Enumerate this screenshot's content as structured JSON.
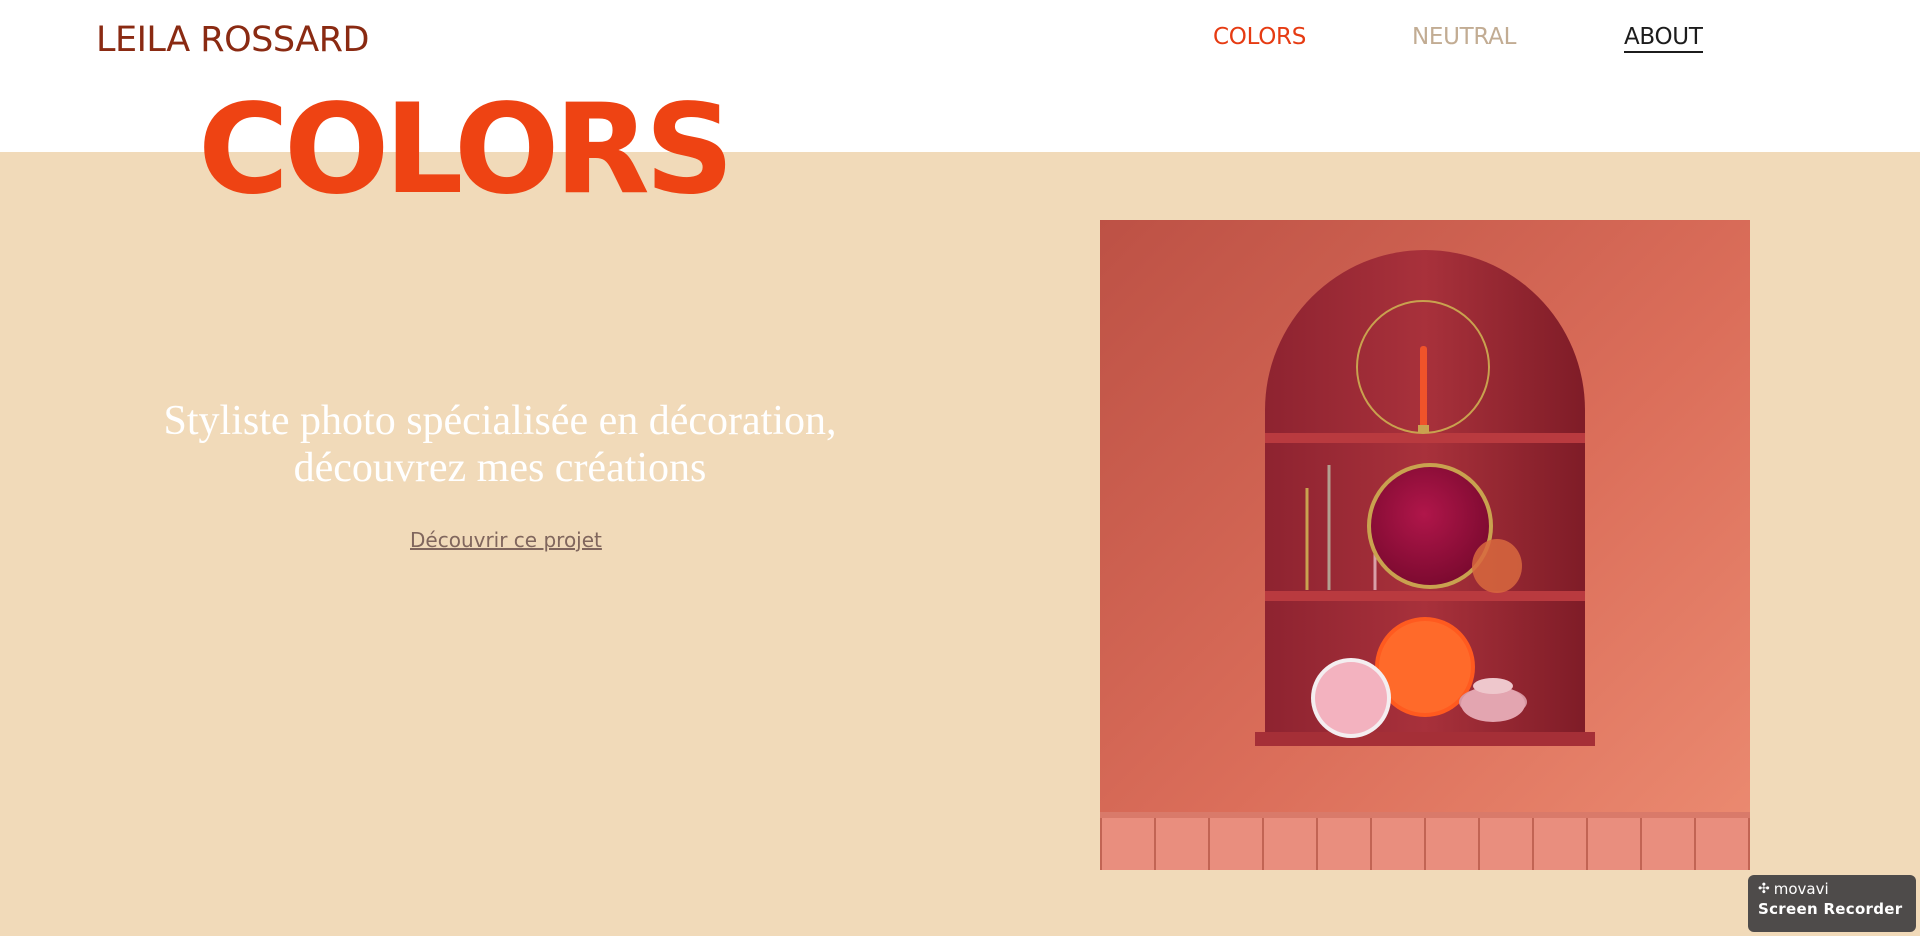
{
  "site": {
    "logo": "LEILA ROSSARD"
  },
  "nav": {
    "items": [
      {
        "label": "COLORS",
        "color": "#e63b12"
      },
      {
        "label": "NEUTRAL",
        "color": "#c2ac93"
      },
      {
        "label": "ABOUT",
        "color": "#1c1c1c"
      }
    ]
  },
  "hero": {
    "title": "COLORS",
    "tagline_line1": "Styliste photo spécialisée en décoration,",
    "tagline_line2": "découvrez mes créations",
    "cta_label": "Découvrir ce projet",
    "band_color": "#f1dab9",
    "title_color": "#ee4313"
  },
  "photo": {
    "subject": "arched red niche with shelves, candlestick, candle holders, plates and bowls"
  },
  "watermark": {
    "brand": "movavi",
    "product": "Screen Recorder",
    "icon": "movavi-logo-icon"
  }
}
